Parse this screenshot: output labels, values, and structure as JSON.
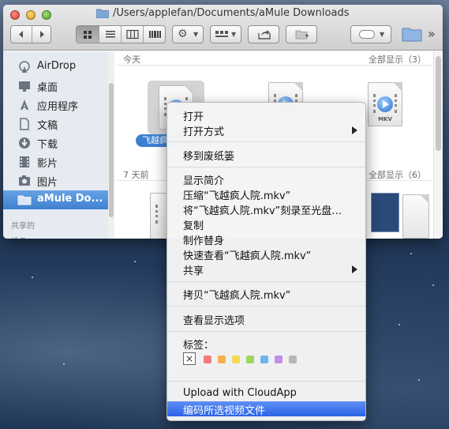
{
  "window": {
    "path": "/Users/applefan/Documents/aMule Downloads"
  },
  "toolbar": {
    "back_icon": "back-arrow-icon",
    "forward_icon": "forward-arrow-icon",
    "views": [
      "icon-view-icon",
      "list-view-icon",
      "column-view-icon",
      "coverflow-view-icon"
    ],
    "action_icon": "gear-icon",
    "arrange_icon": "arrange-icon",
    "share_icon": "share-icon",
    "new_folder_icon": "new-folder-icon",
    "search_placeholder": "",
    "overflow": "»"
  },
  "sidebar": {
    "items": [
      {
        "label": "AirDrop",
        "icon": "airdrop-icon"
      },
      {
        "label": "桌面",
        "icon": "desktop-icon"
      },
      {
        "label": "应用程序",
        "icon": "applications-icon"
      },
      {
        "label": "文稿",
        "icon": "documents-icon"
      },
      {
        "label": "下载",
        "icon": "downloads-icon"
      },
      {
        "label": "影片",
        "icon": "movies-icon"
      },
      {
        "label": "图片",
        "icon": "pictures-icon"
      },
      {
        "label": "aMule Do...",
        "icon": "folder-icon",
        "selected": true
      }
    ],
    "section_shared": "共享的",
    "section_devices": "设备"
  },
  "content": {
    "groups": [
      {
        "title": "今天",
        "show_all": "全部显示（3）"
      },
      {
        "title": "7 天前",
        "show_all": "全部显示（6）"
      }
    ],
    "selected_file_label": "飞越疯人院.mkv",
    "ext_label": "MKV"
  },
  "context_menu": {
    "items": {
      "open": "打开",
      "open_with": "打开方式",
      "move_to_trash": "移到废纸篓",
      "get_info": "显示简介",
      "compress": "压缩“飞越疯人院.mkv”",
      "burn": "将“飞越疯人院.mkv”刻录至光盘…",
      "duplicate": "复制",
      "make_alias": "制作替身",
      "quick_look": "快速查看“飞越疯人院.mkv”",
      "share": "共享",
      "copy": "拷贝“飞越疯人院.mkv”",
      "view_options": "查看显示选项",
      "tags_label": "标签：",
      "upload": "Upload with CloudApp",
      "encode": "编码所选视频文件"
    },
    "tag_none": "×",
    "tag_colors": [
      "#f27b7b",
      "#f5b14b",
      "#f2da55",
      "#9fd662",
      "#6cb6f0",
      "#c48ee8",
      "#b8b8b8"
    ]
  }
}
